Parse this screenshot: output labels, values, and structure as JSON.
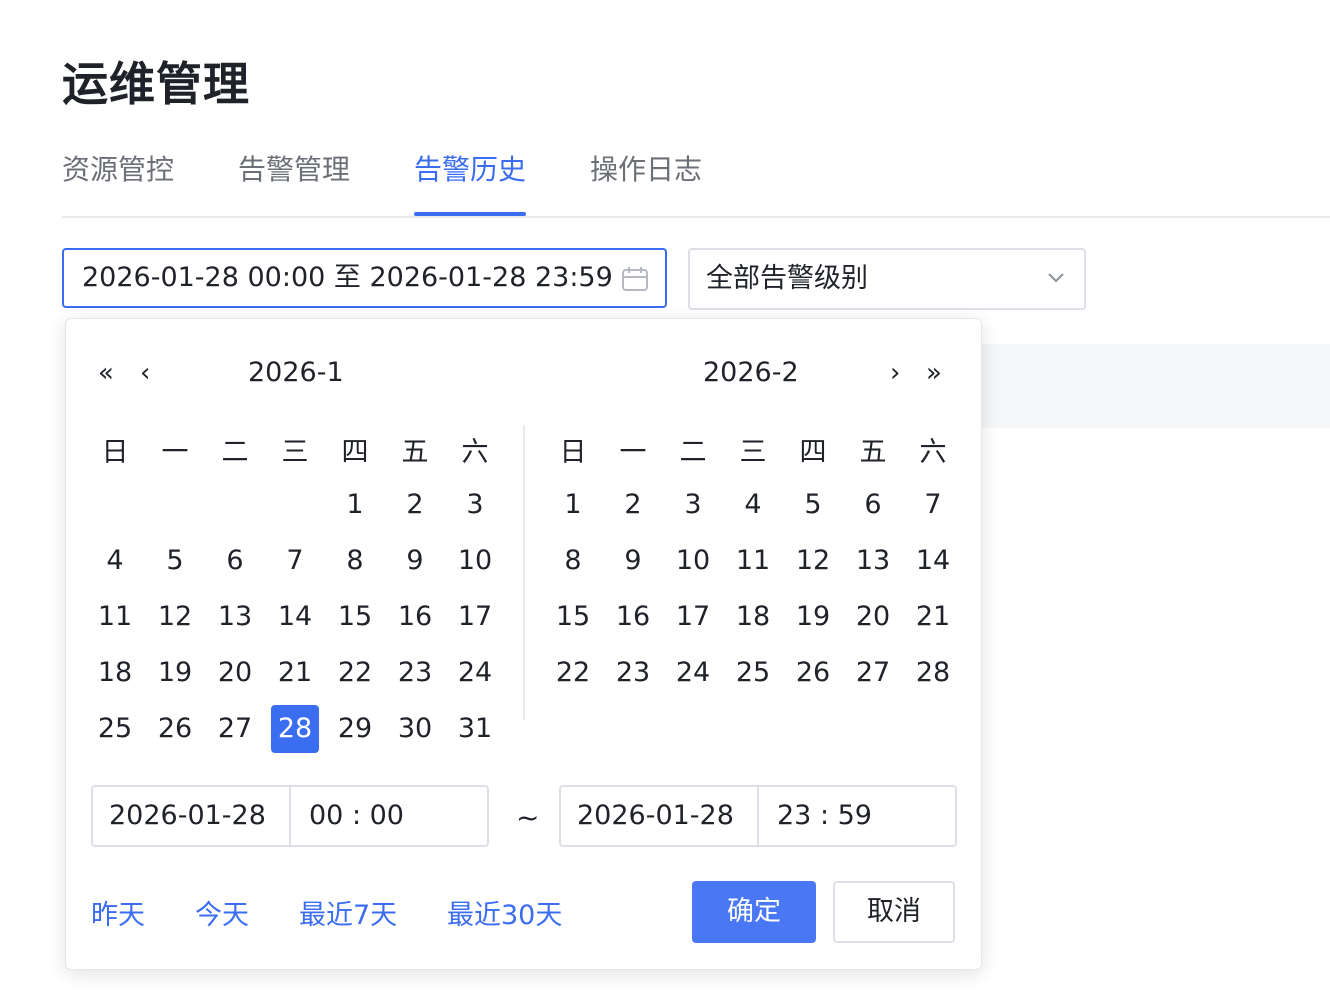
{
  "page": {
    "title": "运维管理"
  },
  "tabs": [
    {
      "label": "资源管控",
      "active": false
    },
    {
      "label": "告警管理",
      "active": false
    },
    {
      "label": "告警历史",
      "active": true
    },
    {
      "label": "操作日志",
      "active": false
    }
  ],
  "filters": {
    "range_value": "2026-01-28 00:00 至 2026-01-28 23:59",
    "range_icon": "calendar-icon",
    "level_value": "全部告警级别",
    "level_icon": "chevron-down-icon"
  },
  "picker": {
    "left_month": "2026-1",
    "right_month": "2026-2",
    "weekdays": [
      "日",
      "一",
      "二",
      "三",
      "四",
      "五",
      "六"
    ],
    "left_days": [
      "",
      "",
      "",
      "",
      "1",
      "2",
      "3",
      "4",
      "5",
      "6",
      "7",
      "8",
      "9",
      "10",
      "11",
      "12",
      "13",
      "14",
      "15",
      "16",
      "17",
      "18",
      "19",
      "20",
      "21",
      "22",
      "23",
      "24",
      "25",
      "26",
      "27",
      "28",
      "29",
      "30",
      "31"
    ],
    "right_days": [
      "1",
      "2",
      "3",
      "4",
      "5",
      "6",
      "7",
      "8",
      "9",
      "10",
      "11",
      "12",
      "13",
      "14",
      "15",
      "16",
      "17",
      "18",
      "19",
      "20",
      "21",
      "22",
      "23",
      "24",
      "25",
      "26",
      "27",
      "28"
    ],
    "selected_day": "28",
    "start_date": "2026-01-28",
    "start_time": "00 : 00",
    "separator": "~",
    "end_date": "2026-01-28",
    "end_time": "23 : 59",
    "quick": [
      "昨天",
      "今天",
      "最近7天",
      "最近30天"
    ],
    "confirm_label": "确定",
    "cancel_label": "取消",
    "accent_color": "#3a6df0"
  }
}
